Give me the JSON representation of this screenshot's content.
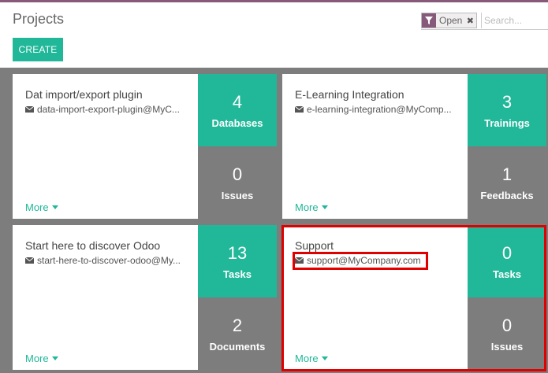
{
  "header": {
    "title": "Projects",
    "create_label": "CREATE"
  },
  "search": {
    "facet_value": "Open",
    "facet_remove_glyph": "✖",
    "placeholder": "Search...",
    "facet_icon": "filter-icon"
  },
  "colors": {
    "accent": "#21b799",
    "brand": "#875a7b",
    "highlight": "#e00000",
    "muted_tile": "#7d7d7d"
  },
  "projects": [
    {
      "name": "Dat import/export plugin",
      "alias": "data-import-export-plugin@MyC...",
      "more": "More",
      "stat1": {
        "value": "4",
        "label": "Databases"
      },
      "stat2": {
        "value": "0",
        "label": "Issues"
      }
    },
    {
      "name": "E-Learning Integration",
      "alias": "e-learning-integration@MyComp...",
      "more": "More",
      "stat1": {
        "value": "3",
        "label": "Trainings"
      },
      "stat2": {
        "value": "1",
        "label": "Feedbacks"
      }
    },
    {
      "name": "Start here to discover Odoo",
      "alias": "start-here-to-discover-odoo@My...",
      "more": "More",
      "stat1": {
        "value": "13",
        "label": "Tasks"
      },
      "stat2": {
        "value": "2",
        "label": "Documents"
      }
    },
    {
      "name": "Support",
      "alias": "support@MyCompany.com",
      "more": "More",
      "stat1": {
        "value": "0",
        "label": "Tasks"
      },
      "stat2": {
        "value": "0",
        "label": "Issues"
      }
    }
  ]
}
